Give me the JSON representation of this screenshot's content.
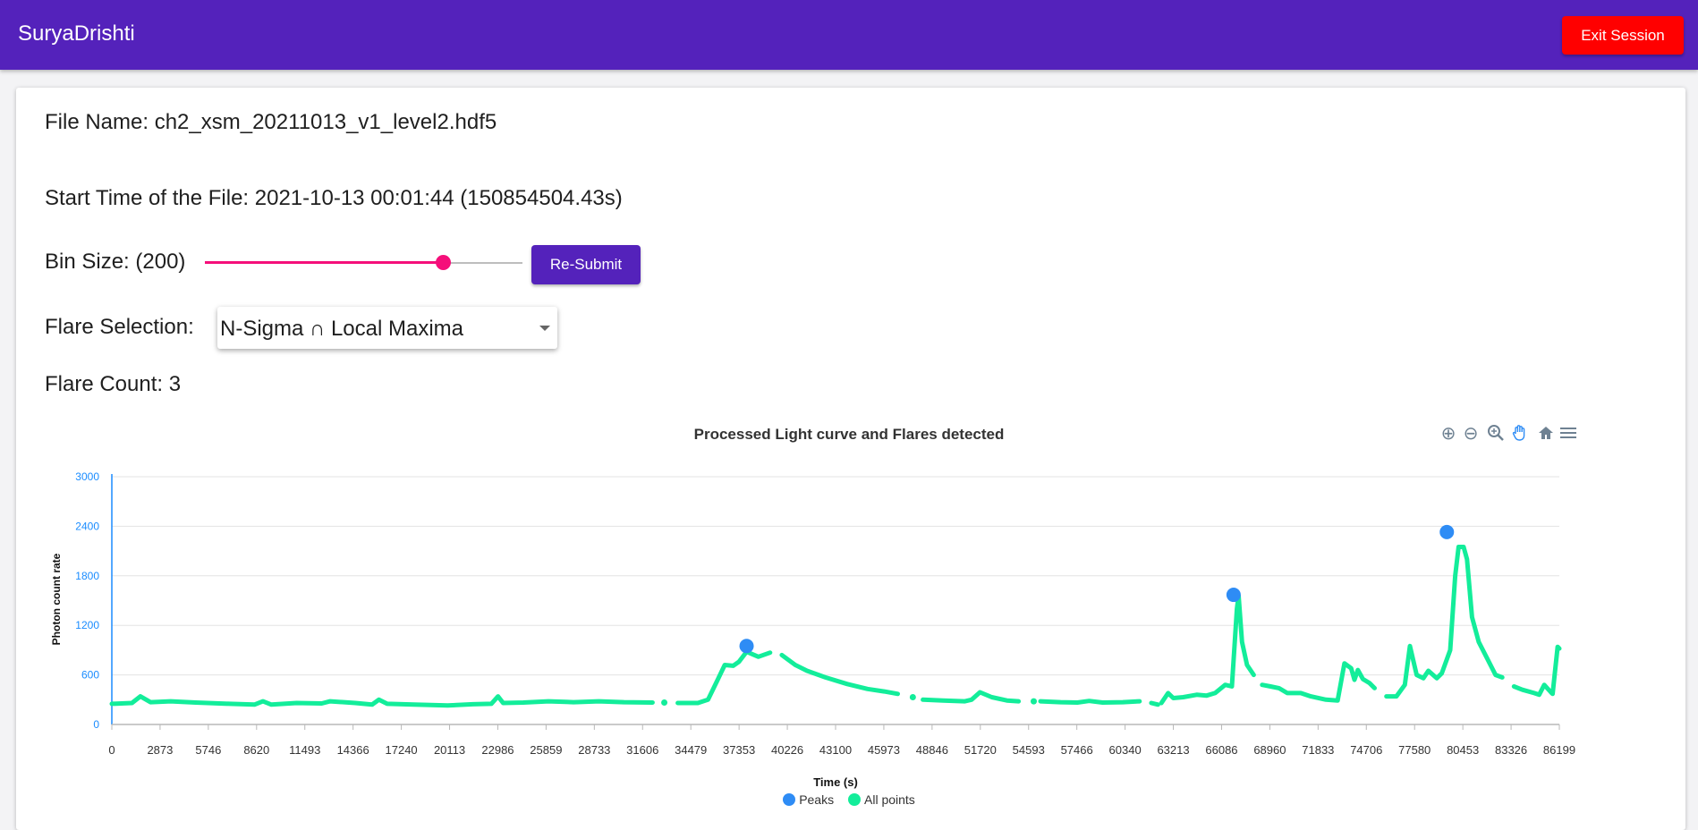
{
  "app": {
    "title": "SuryaDrishti",
    "exit_label": "Exit Session"
  },
  "file": {
    "name_label": "File Name: ch2_xsm_20211013_v1_level2.hdf5",
    "start_time_label": "Start Time of the File: 2021-10-13 00:01:44 (150854504.43s)"
  },
  "controls": {
    "bin_size_label": "Bin Size: (200)",
    "bin_slider_value": 0.75,
    "resubmit_label": "Re-Submit",
    "flare_selection_label": "Flare Selection:",
    "flare_selection_value": "N-Sigma ∩ Local Maxima",
    "flare_count_label": "Flare Count: 3"
  },
  "toolbar": {
    "icons": [
      "zoom-in-icon",
      "zoom-out-icon",
      "zoom-select-icon",
      "pan-icon",
      "home-icon",
      "menu-icon"
    ]
  },
  "colors": {
    "appbar": "#5422bb",
    "exit": "#ff0000",
    "accent": "#f50f7a",
    "peaks": "#2e8cf5",
    "all_points": "#13ed9a"
  },
  "chart_data": {
    "type": "line",
    "title": "Processed Light curve and Flares detected",
    "xlabel": "Time (s)",
    "ylabel": "Photon count rate",
    "xlim": [
      0,
      86199
    ],
    "ylim": [
      0,
      3000
    ],
    "x_ticks": [
      "0",
      "2873",
      "5746",
      "8620",
      "11493",
      "14366",
      "17240",
      "20113",
      "22986",
      "25859",
      "28733",
      "31606",
      "34479",
      "37353",
      "40226",
      "43100",
      "45973",
      "48846",
      "51720",
      "54593",
      "57466",
      "60340",
      "63213",
      "66086",
      "68960",
      "71833",
      "74706",
      "77580",
      "80453",
      "83326",
      "86199"
    ],
    "y_ticks": [
      "0",
      "600",
      "1200",
      "1800",
      "2400",
      "3000"
    ],
    "grid": true,
    "legend": "bottom-center",
    "series": [
      {
        "name": "All points",
        "segments": [
          [
            [
              0,
              250
            ],
            [
              1200,
              260
            ],
            [
              1700,
              340
            ],
            [
              2300,
              270
            ],
            [
              3500,
              280
            ],
            [
              5000,
              265
            ],
            [
              7000,
              250
            ],
            [
              8500,
              240
            ],
            [
              9000,
              280
            ],
            [
              9500,
              240
            ],
            [
              11000,
              260
            ],
            [
              12500,
              255
            ],
            [
              13000,
              280
            ],
            [
              14500,
              260
            ],
            [
              15500,
              240
            ],
            [
              15900,
              300
            ],
            [
              16400,
              250
            ],
            [
              18000,
              240
            ],
            [
              20000,
              230
            ],
            [
              21500,
              245
            ],
            [
              22600,
              250
            ],
            [
              23000,
              340
            ],
            [
              23300,
              260
            ],
            [
              24500,
              265
            ],
            [
              26000,
              280
            ],
            [
              27500,
              270
            ],
            [
              29000,
              280
            ],
            [
              30500,
              270
            ],
            [
              32200,
              265
            ]
          ],
          [
            [
              32900,
              265
            ]
          ],
          [
            [
              33700,
              260
            ],
            [
              34900,
              260
            ],
            [
              35500,
              300
            ],
            [
              36100,
              550
            ],
            [
              36500,
              720
            ],
            [
              37000,
              710
            ],
            [
              37353,
              760
            ],
            [
              37800,
              880
            ],
            [
              38500,
              820
            ],
            [
              39200,
              870
            ]
          ],
          [
            [
              39900,
              840
            ],
            [
              40700,
              720
            ],
            [
              41400,
              650
            ],
            [
              42500,
              570
            ],
            [
              43800,
              490
            ],
            [
              45000,
              430
            ],
            [
              46000,
              400
            ],
            [
              46800,
              370
            ]
          ],
          [
            [
              47700,
              330
            ]
          ],
          [
            [
              48300,
              300
            ],
            [
              49500,
              290
            ],
            [
              50800,
              280
            ],
            [
              51200,
              300
            ],
            [
              51700,
              390
            ],
            [
              52400,
              330
            ],
            [
              53300,
              290
            ],
            [
              54000,
              280
            ]
          ],
          [
            [
              54900,
              280
            ]
          ],
          [
            [
              55300,
              280
            ],
            [
              56500,
              270
            ],
            [
              57500,
              265
            ],
            [
              58200,
              285
            ],
            [
              59000,
              265
            ],
            [
              60200,
              270
            ],
            [
              61200,
              280
            ]
          ],
          [
            [
              61900,
              260
            ],
            [
              62300,
              240
            ]
          ],
          [
            [
              62500,
              260
            ],
            [
              62900,
              380
            ],
            [
              63213,
              320
            ],
            [
              63800,
              330
            ],
            [
              64600,
              360
            ],
            [
              65200,
              350
            ],
            [
              65700,
              380
            ],
            [
              66300,
              480
            ],
            [
              66700,
              460
            ],
            [
              67000,
              1400
            ],
            [
              67100,
              1560
            ],
            [
              67300,
              1000
            ],
            [
              67600,
              720
            ],
            [
              68000,
              600
            ]
          ],
          [
            [
              68500,
              480
            ],
            [
              69000,
              460
            ],
            [
              69500,
              440
            ],
            [
              70000,
              380
            ],
            [
              70800,
              380
            ],
            [
              71400,
              340
            ],
            [
              72300,
              300
            ],
            [
              73000,
              290
            ],
            [
              73400,
              740
            ],
            [
              73800,
              680
            ],
            [
              74000,
              540
            ],
            [
              74200,
              660
            ],
            [
              74500,
              550
            ],
            [
              74900,
              500
            ],
            [
              75200,
              440
            ]
          ],
          [
            [
              75900,
              340
            ],
            [
              76500,
              340
            ],
            [
              77000,
              480
            ],
            [
              77300,
              950
            ],
            [
              77700,
              600
            ],
            [
              78100,
              560
            ],
            [
              78400,
              650
            ],
            [
              78900,
              560
            ],
            [
              79200,
              620
            ],
            [
              79700,
              900
            ],
            [
              80000,
              1800
            ],
            [
              80200,
              2150
            ],
            [
              80500,
              2150
            ],
            [
              80700,
              2000
            ],
            [
              81000,
              1300
            ],
            [
              81400,
              1000
            ],
            [
              81900,
              800
            ],
            [
              82400,
              600
            ],
            [
              82800,
              570
            ]
          ],
          [
            [
              83500,
              460
            ],
            [
              84000,
              420
            ],
            [
              84700,
              380
            ],
            [
              85000,
              360
            ],
            [
              85300,
              480
            ],
            [
              85700,
              390
            ],
            [
              85800,
              370
            ],
            [
              86100,
              940
            ],
            [
              86199,
              920
            ]
          ]
        ]
      },
      {
        "name": "Peaks",
        "points": [
          [
            37800,
            950
          ],
          [
            66800,
            1570
          ],
          [
            79500,
            2330
          ]
        ]
      }
    ]
  }
}
